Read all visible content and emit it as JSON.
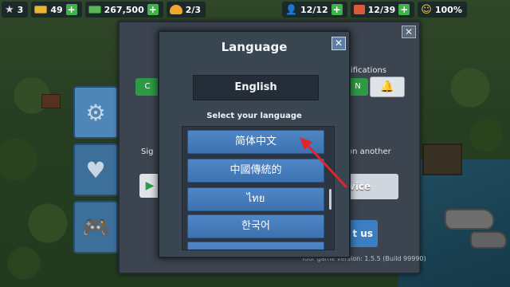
{
  "topbar": {
    "level": "3",
    "gold": "49",
    "cash": "267,500",
    "boats": "2/3",
    "population": "12/12",
    "factories": "12/39",
    "happiness": "100%",
    "plus_label": "+"
  },
  "settings": {
    "close_label": "✕",
    "notifications_label": "tifications",
    "notif_toggle_label": "N",
    "left_toggle_label": "C",
    "sign_label": "Sig",
    "sign_device_label": "on another",
    "device_button_label": "vice",
    "contact_button_label": "t us",
    "version": "Your game version: 1.5.5 (Build 99990)"
  },
  "dialog": {
    "title": "Language",
    "close_label": "✕",
    "current_language": "English",
    "select_label": "Select your language",
    "languages": [
      "简体中文",
      "中國傳統的",
      "ไทย",
      "한국어",
      ""
    ]
  },
  "colors": {
    "accent": "#4f86c6",
    "annotation": "#e0242a"
  },
  "icons": {
    "star": "★",
    "person": "👤",
    "smile": "☺",
    "bell": "🔔",
    "gamepad": "🎮",
    "gear": "⚙"
  }
}
